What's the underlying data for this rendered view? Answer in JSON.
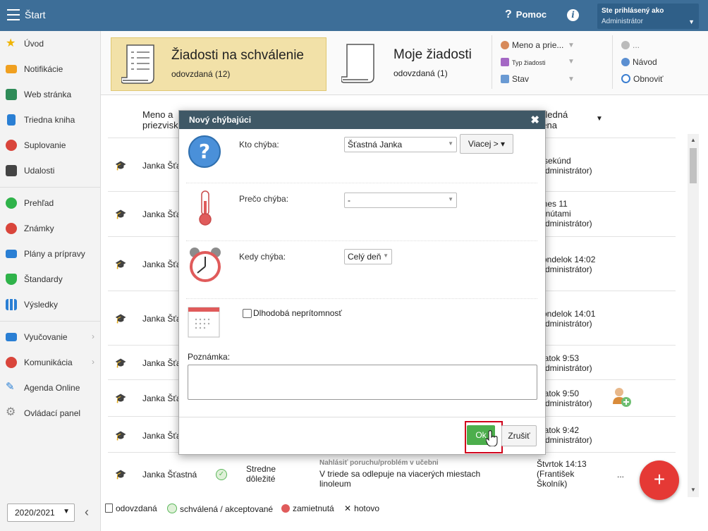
{
  "topbar": {
    "title": "Štart",
    "help": "Pomoc",
    "user_line1": "Ste prihlásený ako",
    "user_line2": "Administrátor"
  },
  "sidebar": {
    "items": [
      {
        "label": "Úvod",
        "color": "#f0b400",
        "icon": "star-icon"
      },
      {
        "label": "Notifikácie",
        "color": "#f0a020",
        "icon": "envelope-icon"
      },
      {
        "label": "Web stránka",
        "color": "#2e8b57",
        "icon": "home-icon"
      },
      {
        "label": "Triedna kniha",
        "color": "#2a7fd4",
        "icon": "book-icon"
      },
      {
        "label": "Suplovanie",
        "color": "#d9453b",
        "icon": "person-icon"
      },
      {
        "label": "Udalosti",
        "color": "#444444",
        "icon": "calendar-icon"
      },
      {
        "label": "Prehľad",
        "color": "#2fb34a",
        "icon": "check-circle-icon"
      },
      {
        "label": "Známky",
        "color": "#d9453b",
        "icon": "grade-icon"
      },
      {
        "label": "Plány a prípravy",
        "color": "#2a7fd4",
        "icon": "briefcase-icon"
      },
      {
        "label": "Štandardy",
        "color": "#2fb34a",
        "icon": "shield-icon"
      },
      {
        "label": "Výsledky",
        "color": "#2a7fd4",
        "icon": "bar-chart-icon"
      },
      {
        "label": "Vyučovanie",
        "color": "#2a7fd4",
        "icon": "open-book-icon"
      },
      {
        "label": "Komunikácia",
        "color": "#d9453b",
        "icon": "chat-icon"
      },
      {
        "label": "Agenda Online",
        "color": "#2a7fd4",
        "icon": "pen-icon"
      },
      {
        "label": "Ovládací panel",
        "color": "#888888",
        "icon": "gear-icon"
      }
    ],
    "year": "2020/2021"
  },
  "tabs": [
    {
      "title": "Žiadosti na schválenie",
      "sub": "odovzdaná (12)"
    },
    {
      "title": "Moje žiadosti",
      "sub": "odovzdaná (1)"
    }
  ],
  "filters": {
    "name": "Meno a prie...",
    "type": "Typ žiadosti",
    "state": "Stav",
    "more": "...",
    "guide": "Návod",
    "refresh": "Obnoviť"
  },
  "table": {
    "col_name": "Meno a priezvisko",
    "col_last": "Posledná zmena",
    "rows": [
      {
        "name": "Janka Šťastná",
        "last": [
          "5 sekúnd",
          "(Administrátor)"
        ]
      },
      {
        "name": "Janka Šťastná",
        "last": [
          "Dnes 11",
          "minútami",
          "(Administrátor)"
        ]
      },
      {
        "name": "Janka Šťastná",
        "last": [
          "Pondelok 14:02",
          "(Administrátor)"
        ]
      },
      {
        "name": "Janka Šťastná",
        "last": [
          "Pondelok 14:01",
          "(Administrátor)"
        ]
      },
      {
        "name": "Janka Šťastná",
        "last": [
          "Piatok 9:53",
          "(Administrátor)"
        ]
      },
      {
        "name": "Janka Šťastná",
        "last": [
          "Piatok 9:50",
          "(Administrátor)"
        ]
      },
      {
        "name": "Janka Šťastná",
        "last": [
          "Piatok 9:42",
          "(Administrátor)"
        ]
      },
      {
        "name": "Janka Šťastná",
        "priority": "Stredne dôležité",
        "category": "Nahlásiť poruchu/problém v učebni",
        "desc": "V triede sa odlepuje na viacerých miestach linoleum",
        "last": [
          "Štvrtok 14:13",
          "(František",
          "Školník)"
        ],
        "more": "..."
      }
    ]
  },
  "legend": {
    "submitted": "odovzdaná",
    "approved": "schválená / akceptované",
    "rejected": "zamietnutá",
    "done": "hotovo"
  },
  "modal": {
    "title": "Nový chýbajúci",
    "who_label": "Kto chýba:",
    "who_value": "Šťastná Janka",
    "more_button": "Viacej > ▾",
    "why_label": "Prečo chýba:",
    "why_value": "-",
    "when_label": "Kedy chýba:",
    "when_value": "Celý deň",
    "longterm_label": "Dlhodobá neprítomnosť",
    "note_label": "Poznámka:",
    "ok": "Ok",
    "cancel": "Zrušiť"
  }
}
